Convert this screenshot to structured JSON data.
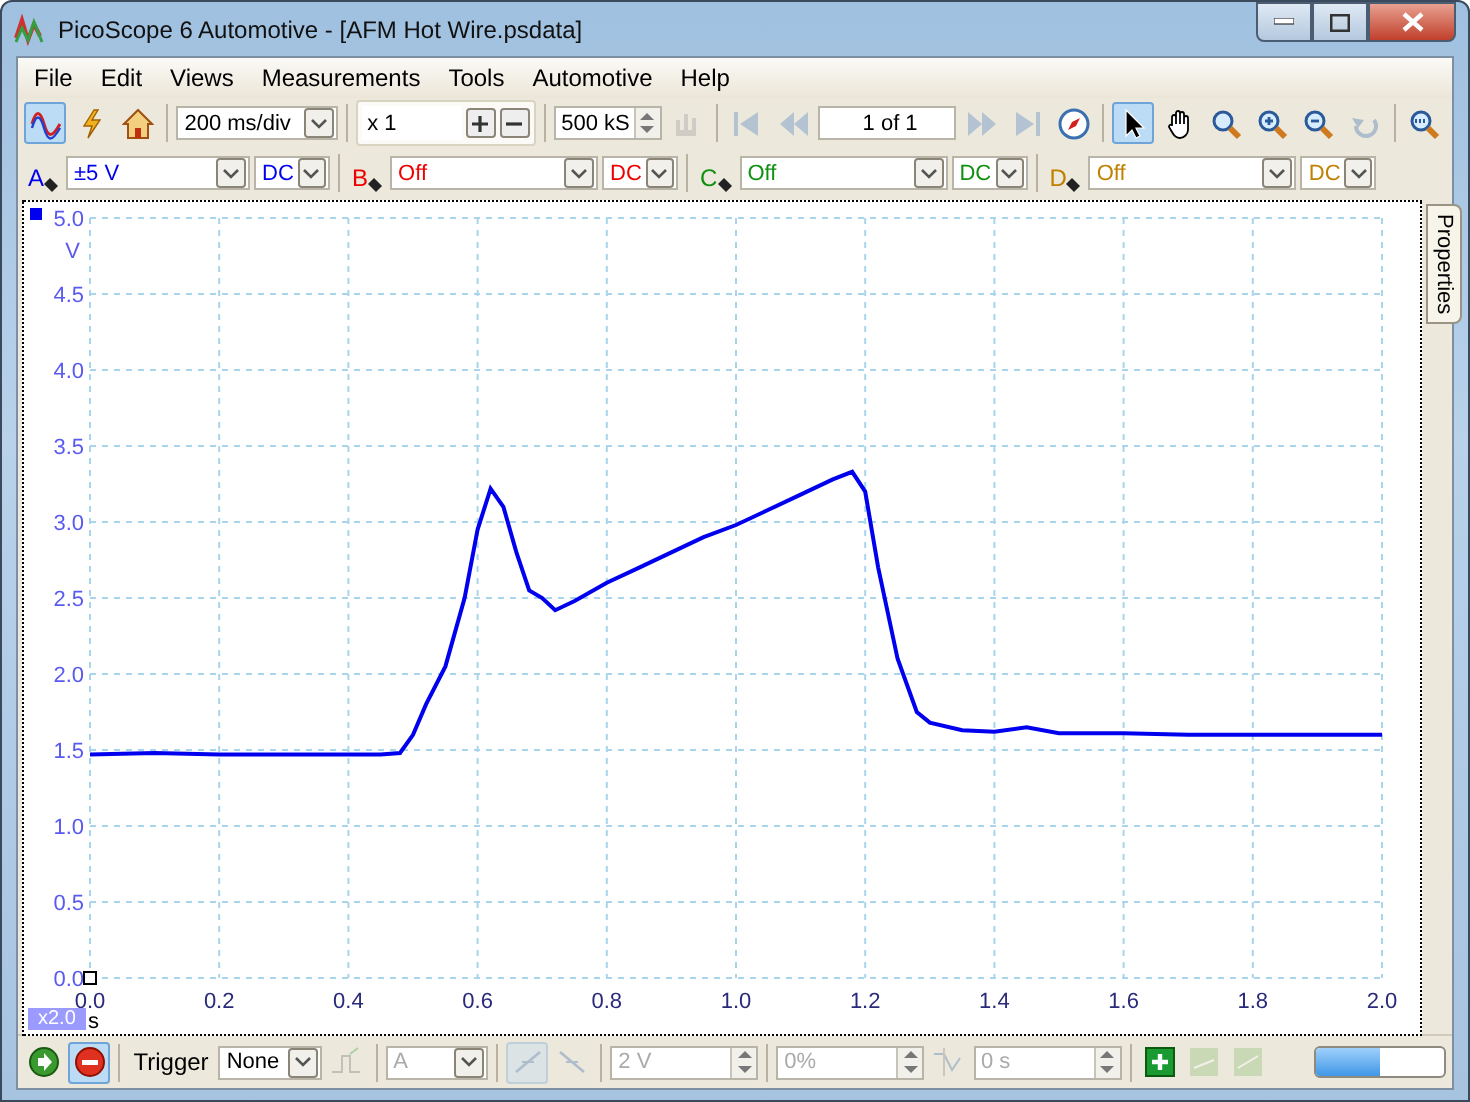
{
  "window": {
    "title": "PicoScope 6 Automotive - [AFM Hot Wire.psdata]"
  },
  "menu": [
    "File",
    "Edit",
    "Views",
    "Measurements",
    "Tools",
    "Automotive",
    "Help"
  ],
  "toolbar": [
    {
      "kind": "scope-mode",
      "selected": true,
      "disabled": false
    },
    {
      "kind": "auto-setup",
      "selected": false,
      "disabled": false
    },
    {
      "kind": "default-setup",
      "selected": false,
      "disabled": false
    },
    {
      "kind": "separator"
    },
    {
      "kind": "select",
      "value": "200 ms/div"
    },
    {
      "kind": "separator"
    },
    {
      "kind": "multiplier",
      "value": "x 1"
    },
    {
      "kind": "separator"
    },
    {
      "kind": "spinner",
      "value": "500 kS",
      "disabled": false
    },
    {
      "kind": "signal-generator",
      "selected": false,
      "disabled": true
    },
    {
      "kind": "separator"
    },
    {
      "kind": "first",
      "selected": false,
      "disabled": true
    },
    {
      "kind": "previous",
      "selected": false,
      "disabled": true
    },
    {
      "kind": "page",
      "value": "1 of 1"
    },
    {
      "kind": "next",
      "selected": false,
      "disabled": true
    },
    {
      "kind": "last",
      "selected": false,
      "disabled": true
    },
    {
      "kind": "compass",
      "selected": false,
      "disabled": false
    },
    {
      "kind": "separator"
    },
    {
      "kind": "pointer",
      "selected": true,
      "disabled": false
    },
    {
      "kind": "hand",
      "selected": false,
      "disabled": false
    },
    {
      "kind": "zoom-area",
      "selected": false,
      "disabled": false
    },
    {
      "kind": "zoom-in",
      "selected": false,
      "disabled": false
    },
    {
      "kind": "zoom-out",
      "selected": false,
      "disabled": false
    },
    {
      "kind": "undo-zoom",
      "selected": false,
      "disabled": true
    },
    {
      "kind": "separator"
    },
    {
      "kind": "zoom-fit",
      "selected": false,
      "disabled": false
    }
  ],
  "channels": [
    {
      "letter": "A",
      "color": "#0000ee",
      "range": "±5 V",
      "coupling": "DC"
    },
    {
      "letter": "B",
      "color": "#ee0000",
      "range": "Off",
      "coupling": "DC"
    },
    {
      "letter": "C",
      "color": "#109010",
      "range": "Off",
      "coupling": "DC"
    },
    {
      "letter": "D",
      "color": "#c08000",
      "range": "Off",
      "coupling": "DC"
    }
  ],
  "scope": {
    "y_unit": "V",
    "x_unit": "s",
    "zoom_badge": "x2.0",
    "chart_data": {
      "type": "line",
      "x": [
        0,
        0.1,
        0.2,
        0.3,
        0.4,
        0.45,
        0.48,
        0.5,
        0.52,
        0.55,
        0.58,
        0.6,
        0.62,
        0.64,
        0.66,
        0.68,
        0.7,
        0.72,
        0.75,
        0.8,
        0.85,
        0.9,
        0.95,
        1.0,
        1.05,
        1.1,
        1.15,
        1.18,
        1.2,
        1.22,
        1.25,
        1.28,
        1.3,
        1.35,
        1.4,
        1.45,
        1.5,
        1.6,
        1.7,
        1.8,
        1.9,
        2.0
      ],
      "grid": true,
      "series": [
        {
          "color": "#0000ee",
          "values": [
            1.47,
            1.48,
            1.47,
            1.47,
            1.47,
            1.47,
            1.48,
            1.6,
            1.8,
            2.05,
            2.5,
            2.95,
            3.22,
            3.1,
            2.8,
            2.55,
            2.5,
            2.42,
            2.48,
            2.6,
            2.7,
            2.8,
            2.9,
            2.98,
            3.08,
            3.18,
            3.28,
            3.33,
            3.2,
            2.7,
            2.1,
            1.75,
            1.68,
            1.63,
            1.62,
            1.65,
            1.61,
            1.61,
            1.6,
            1.6,
            1.6,
            1.6
          ]
        }
      ],
      "xlim": [
        0,
        2
      ],
      "ylim": [
        0,
        5
      ],
      "xticks": [
        {
          "value": 0,
          "label": "0.0"
        },
        {
          "value": 0.2,
          "label": "0.2"
        },
        {
          "value": 0.4,
          "label": "0.4"
        },
        {
          "value": 0.6,
          "label": "0.6"
        },
        {
          "value": 0.8,
          "label": "0.8"
        },
        {
          "value": 1,
          "label": "1.0"
        },
        {
          "value": 1.2,
          "label": "1.2"
        },
        {
          "value": 1.4,
          "label": "1.4"
        },
        {
          "value": 1.6,
          "label": "1.6"
        },
        {
          "value": 1.8,
          "label": "1.8"
        },
        {
          "value": 2,
          "label": "2.0"
        }
      ],
      "yticks": [
        {
          "value": 0,
          "label": "0.0"
        },
        {
          "value": 0.5,
          "label": "0.5"
        },
        {
          "value": 1,
          "label": "1.0"
        },
        {
          "value": 1.5,
          "label": "1.5"
        },
        {
          "value": 2,
          "label": "2.0"
        },
        {
          "value": 2.5,
          "label": "2.5"
        },
        {
          "value": 3,
          "label": "3.0"
        },
        {
          "value": 3.5,
          "label": "3.5"
        },
        {
          "value": 4,
          "label": "4.0"
        },
        {
          "value": 4.5,
          "label": "4.5"
        },
        {
          "value": 5,
          "label": "5.0"
        }
      ]
    }
  },
  "side_tab": {
    "label": "Properties"
  },
  "bottom_bar": [
    {
      "kind": "start",
      "selected": false,
      "disabled": false
    },
    {
      "kind": "stop",
      "selected": true,
      "disabled": false
    },
    {
      "kind": "separator"
    },
    {
      "kind": "label",
      "value": "Trigger"
    },
    {
      "kind": "select",
      "value": "None",
      "disabled": false
    },
    {
      "kind": "trigger-type",
      "selected": false,
      "disabled": true
    },
    {
      "kind": "separator"
    },
    {
      "kind": "select",
      "value": "A",
      "disabled": true
    },
    {
      "kind": "separator"
    },
    {
      "kind": "rising-edge",
      "selected": true,
      "disabled": true
    },
    {
      "kind": "falling-edge",
      "selected": false,
      "disabled": true
    },
    {
      "kind": "separator"
    },
    {
      "kind": "spinner",
      "value": "2 V",
      "disabled": true
    },
    {
      "kind": "separator"
    },
    {
      "kind": "spinner",
      "value": "0%",
      "disabled": true
    },
    {
      "kind": "pretrigger",
      "selected": false,
      "disabled": true
    },
    {
      "kind": "spinner",
      "value": "0 s",
      "disabled": true
    },
    {
      "kind": "separator"
    },
    {
      "kind": "add-measurement",
      "selected": false,
      "disabled": false
    },
    {
      "kind": "edit-measurement",
      "selected": false,
      "disabled": true
    },
    {
      "kind": "delete-measurement",
      "selected": false,
      "disabled": true
    },
    {
      "kind": "progress",
      "level": 0.5
    }
  ]
}
